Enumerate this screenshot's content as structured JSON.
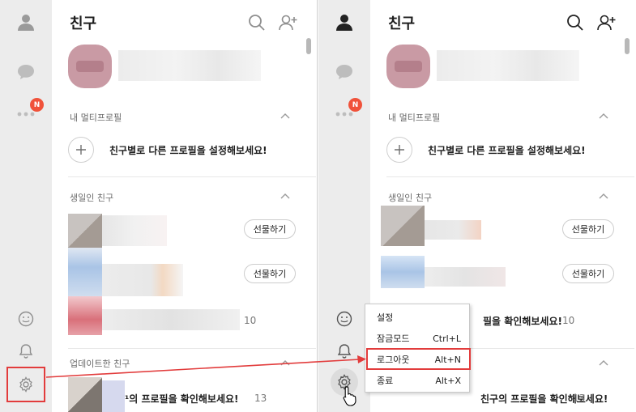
{
  "title": "친구",
  "sections": {
    "multi_profile": "내 멀티프로필",
    "birthday": "생일인 친구",
    "updated": "업데이트한 친구"
  },
  "multi_profile_prompt": "친구별로 다른 프로필을 설정해보세요!",
  "birthday_friends": [
    {
      "action": "선물하기"
    },
    {
      "action": "선물하기"
    }
  ],
  "friend_count_a": "10",
  "update_text_left": "¹의 프로필을 확인해보세요!",
  "update_text_right": "친구의 프로필을 확인해보세요!",
  "update_count": "13",
  "partial_text": "필을 확인해보세요!",
  "badge": "N",
  "settings_menu": [
    {
      "label": "설정",
      "shortcut": ""
    },
    {
      "label": "잠금모드",
      "shortcut": "Ctrl+L"
    },
    {
      "label": "로그아웃",
      "shortcut": "Alt+N"
    },
    {
      "label": "종료",
      "shortcut": "Alt+X"
    }
  ],
  "colors": {
    "accent_red": "#e23c3c",
    "badge": "#f0523a"
  },
  "icons": [
    "person-icon",
    "chat-icon",
    "more-icon",
    "emoji-icon",
    "bell-icon",
    "gear-icon",
    "search-icon",
    "add-friend-icon",
    "plus-icon",
    "chevron-up-icon",
    "hand-cursor-icon"
  ]
}
